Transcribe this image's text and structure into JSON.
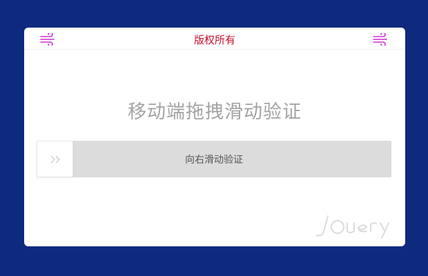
{
  "header": {
    "title": "版权所有",
    "left_icon": "wind-icon",
    "right_icon": "wind-icon",
    "accent_color": "#d12dcf"
  },
  "main": {
    "title": "移动端拖拽滑动验证"
  },
  "slider": {
    "label": "向右滑动验证",
    "handle_icon": "double-chevron-right-icon",
    "progress": 0
  },
  "colors": {
    "background": "#0e2a7e",
    "card": "#ffffff",
    "title_red": "#c8102e",
    "track": "#dcdcdc"
  }
}
